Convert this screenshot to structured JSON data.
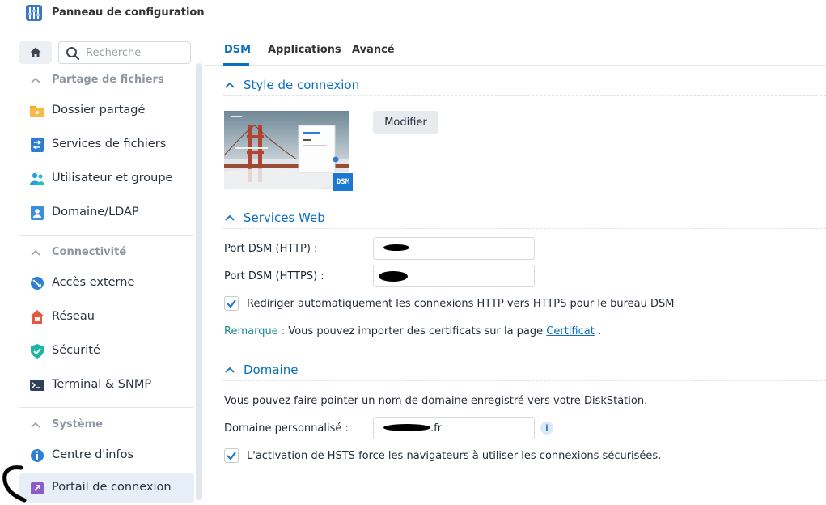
{
  "window": {
    "title": "Panneau de configuration"
  },
  "sidebar": {
    "search_placeholder": "Recherche",
    "sections": [
      {
        "label": "Partage de fichiers",
        "items": [
          {
            "label": "Dossier partagé",
            "icon": "shared-folder-icon"
          },
          {
            "label": "Services de fichiers",
            "icon": "file-services-icon"
          },
          {
            "label": "Utilisateur et groupe",
            "icon": "user-group-icon"
          },
          {
            "label": "Domaine/LDAP",
            "icon": "domain-ldap-icon"
          }
        ]
      },
      {
        "label": "Connectivité",
        "items": [
          {
            "label": "Accès externe",
            "icon": "external-access-icon"
          },
          {
            "label": "Réseau",
            "icon": "network-icon"
          },
          {
            "label": "Sécurité",
            "icon": "security-icon"
          },
          {
            "label": "Terminal & SNMP",
            "icon": "terminal-icon"
          }
        ]
      },
      {
        "label": "Système",
        "items": [
          {
            "label": "Centre d'infos",
            "icon": "info-center-icon"
          },
          {
            "label": "Portail de connexion",
            "icon": "login-portal-icon",
            "active": true
          }
        ]
      }
    ]
  },
  "tabs": [
    {
      "label": "DSM",
      "active": true
    },
    {
      "label": "Applications"
    },
    {
      "label": "Avancé"
    }
  ],
  "login_style": {
    "title": "Style de connexion",
    "modify_button": "Modifier",
    "badge": "DSM"
  },
  "web_services": {
    "title": "Services Web",
    "http_port_label": "Port DSM (HTTP) :",
    "https_port_label": "Port DSM (HTTPS) :",
    "redirect_label": "Rediriger automatiquement les connexions HTTP vers HTTPS pour le bureau DSM",
    "redirect_checked": true,
    "note_prefix": "Remarque :",
    "note_text": "Vous pouvez importer des certificats sur la page",
    "note_link": "Certificat",
    "note_end": "."
  },
  "domain": {
    "title": "Domaine",
    "description": "Vous pouvez faire pointer un nom de domaine enregistré vers votre DiskStation.",
    "custom_label": "Domaine personnalisé :",
    "custom_suffix": ".fr",
    "hsts_label": "L'activation de HSTS force les navigateurs à utiliser les connexions sécurisées.",
    "hsts_checked": true
  },
  "colors": {
    "accent": "#0a6fc2",
    "active_bg": "#e6eef8"
  }
}
